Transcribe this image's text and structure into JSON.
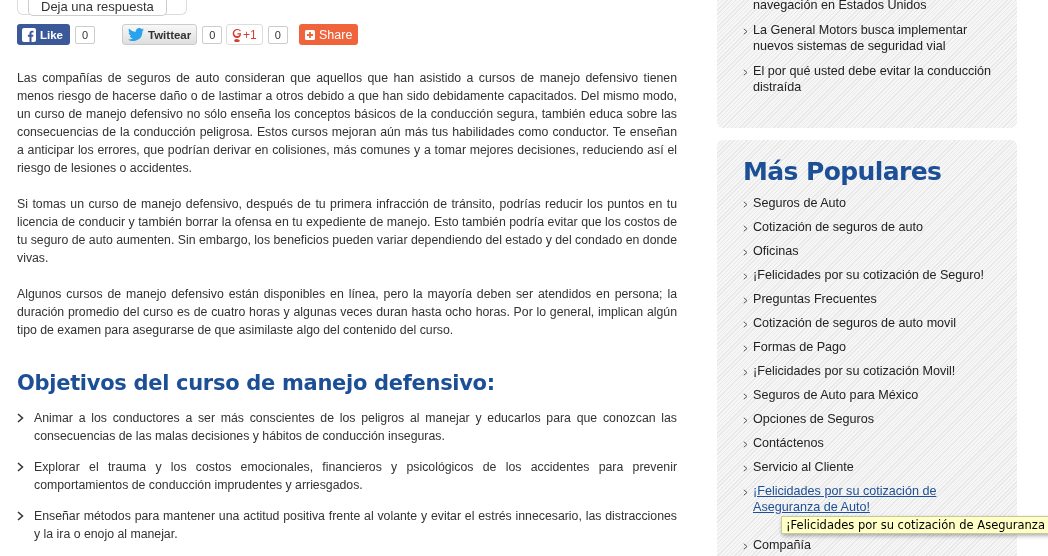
{
  "reply_button": {
    "label": "Deja una respuesta"
  },
  "social": [
    {
      "kind": "facebook",
      "label": "Like",
      "count": "0"
    },
    {
      "kind": "twitter",
      "label": "Twittear",
      "count": "0"
    },
    {
      "kind": "gplus",
      "label": "+1",
      "count": "0"
    },
    {
      "kind": "share",
      "label": "Share"
    }
  ],
  "paragraphs": [
    "Las compañías de seguros de auto consideran que aquellos que han asistido a cursos de manejo defensivo tienen menos riesgo de hacerse daño o de lastimar a otros debido a que han sido debidamente capacitados. Del mismo modo, un curso de manejo defensivo no sólo enseña los conceptos básicos de la conducción segura, también educa sobre las consecuencias de la conducción peligrosa. Estos cursos mejoran aún más tus habilidades como conductor. Te enseñan a anticipar los errores, que podrían derivar en colisiones, más comunes y a tomar mejores decisiones, reduciendo así el riesgo de lesiones o accidentes.",
    "Si tomas un curso de manejo defensivo, después de tu primera infracción de tránsito, podrías reducir los puntos en tu licencia de conducir y también borrar la ofensa en tu expediente de manejo. Esto también podría evitar que los costos de tu seguro de auto aumenten. Sin embargo, los beneficios pueden variar dependiendo del estado y del condado en donde vivas.",
    "Algunos cursos de manejo defensivo están disponibles en línea, pero la mayoría deben ser atendidos en persona; la duración promedio del curso es de cuatro horas y algunas veces duran hasta ocho horas. Por lo general, implican algún tipo de examen para asegurarse de que asimilaste algo del contenido del curso."
  ],
  "objectives": {
    "heading": "Objetivos del curso de manejo defensivo:",
    "items": [
      "Animar a los conductores a ser más conscientes de los peligros al manejar y educarlos para que conozcan las consecuencias de las malas decisiones y hábitos de conducción inseguras.",
      "Explorar el trauma y los costos emocionales, financieros y psicológicos de los accidentes para prevenir comportamientos de conducción imprudentes y arriesgados.",
      "Enseñar métodos para mantener una actitud positiva frente al volante y evitar el estrés innecesario, las distracciones y la ira o enojo al manejar."
    ]
  },
  "news": {
    "cut_item": "navegación en Estados Unidos",
    "items": [
      "La General Motors busca implementar nuevos sistemas de seguridad vial",
      "El por qué usted debe evitar la conducción distraída"
    ]
  },
  "popular": {
    "heading": "Más Populares",
    "items": [
      {
        "label": "Seguros de Auto",
        "hovered": false
      },
      {
        "label": "Cotización de seguros de auto",
        "hovered": false
      },
      {
        "label": "Oficinas",
        "hovered": false
      },
      {
        "label": "¡Felicidades por su cotización de Seguro!",
        "hovered": false
      },
      {
        "label": "Preguntas Frecuentes",
        "hovered": false
      },
      {
        "label": "Cotización de seguros de auto movil",
        "hovered": false
      },
      {
        "label": "Formas de Pago",
        "hovered": false
      },
      {
        "label": "¡Felicidades por su cotización Movil!",
        "hovered": false
      },
      {
        "label": "Seguros de Auto para México",
        "hovered": false
      },
      {
        "label": "Opciones de Seguros",
        "hovered": false
      },
      {
        "label": "Contáctenos",
        "hovered": false
      },
      {
        "label": "Servicio al Cliente",
        "hovered": false
      },
      {
        "label": "¡Felicidades por su cotización de Aseguranza de Auto!",
        "hovered": true
      },
      {
        "label": "Compañía",
        "hovered": false
      }
    ]
  },
  "tooltip": "¡Felicidades por su cotización de Aseguranza"
}
